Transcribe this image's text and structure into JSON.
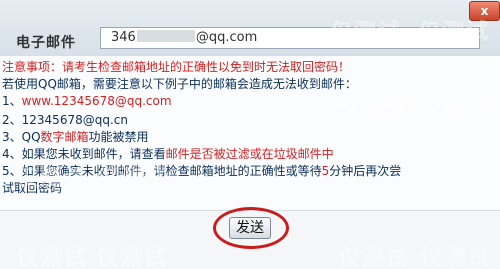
{
  "close_label": "x",
  "email": {
    "label": "电子邮件",
    "value_prefix": "346",
    "value_suffix": "@qq.com"
  },
  "notice": {
    "intro": "注意事项：请考生检查邮箱地址的正确性以免到时无法取回密码！",
    "lead": "若使用QQ邮箱，需要注意以下例子中的邮箱会造成无法收到邮件：",
    "items": [
      {
        "num": "1、",
        "text": "www.12345678@qq.com"
      },
      {
        "num": "2、",
        "text": "12345678@qq.cn"
      },
      {
        "num": "3、",
        "text_a": "QQ",
        "text_b": "数字邮箱",
        "text_c": "功能被禁用"
      },
      {
        "num": "4、",
        "text_a": "如果您未收到邮件，请查看",
        "text_b": "邮件是否被过滤或在垃圾邮件中"
      },
      {
        "num": "5、",
        "text_a": "如果您确实未收到邮件，请检查邮箱地址的正确性或等待",
        "text_b": "5",
        "text_c": "分钟后再次尝"
      }
    ],
    "tail": "试取回密码"
  },
  "send_button": "发送",
  "watermark": "仅测试",
  "colors": {
    "red": "#d62020",
    "blue": "#0b2f5a",
    "circle": "#c91c1c"
  }
}
